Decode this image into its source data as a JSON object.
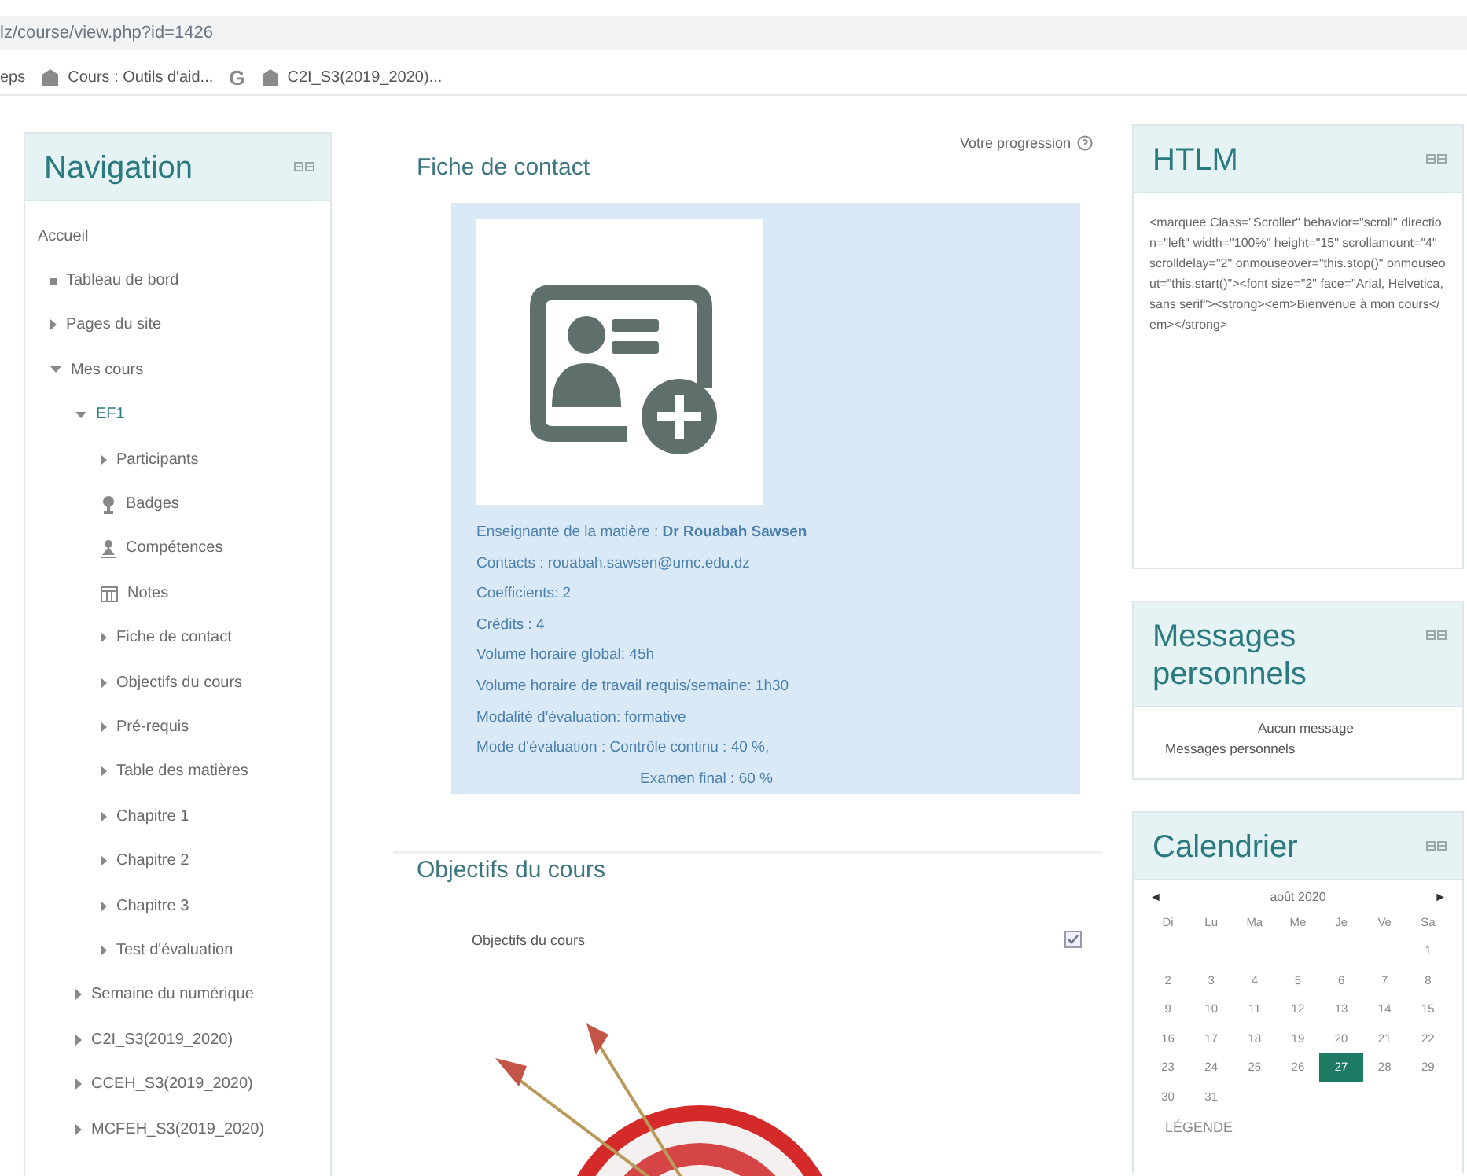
{
  "browser": {
    "url": "lz/course/view.php?id=1426",
    "bookmarks": [
      {
        "kind": "text",
        "label": "eps"
      },
      {
        "kind": "page",
        "label": "Cours : Outils d'aid..."
      },
      {
        "kind": "google",
        "label": "G"
      },
      {
        "kind": "page",
        "label": "C2I_S3(2019_2020)..."
      }
    ]
  },
  "navigation": {
    "title": "Navigation",
    "items": [
      {
        "kind": "plain",
        "label": "Accueil"
      },
      {
        "kind": "leaf",
        "label": "Tableau de bord"
      },
      {
        "kind": "branch",
        "label": "Pages du site",
        "expanded": false
      },
      {
        "kind": "branch",
        "label": "Mes cours",
        "expanded": true,
        "children": [
          {
            "kind": "branch",
            "label": "EF1",
            "expanded": true,
            "current": true,
            "children": [
              {
                "kind": "branch",
                "label": "Participants",
                "expanded": false
              },
              {
                "kind": "badge",
                "label": "Badges"
              },
              {
                "kind": "competence",
                "label": "Compétences"
              },
              {
                "kind": "grades",
                "label": "Notes"
              },
              {
                "kind": "branch",
                "label": "Fiche de contact",
                "expanded": false
              },
              {
                "kind": "branch",
                "label": "Objectifs du cours",
                "expanded": false
              },
              {
                "kind": "branch",
                "label": "Pré-requis",
                "expanded": false
              },
              {
                "kind": "branch",
                "label": "Table des matières",
                "expanded": false
              },
              {
                "kind": "branch",
                "label": "Chapitre 1",
                "expanded": false
              },
              {
                "kind": "branch",
                "label": "Chapitre 2",
                "expanded": false
              },
              {
                "kind": "branch",
                "label": "Chapitre 3",
                "expanded": false
              },
              {
                "kind": "branch",
                "label": "Test d'évaluation",
                "expanded": false
              }
            ]
          },
          {
            "kind": "branch",
            "label": "Semaine du numérique",
            "expanded": false
          },
          {
            "kind": "branch",
            "label": "C2I_S3(2019_2020)",
            "expanded": false
          },
          {
            "kind": "branch",
            "label": "CCEH_S3(2019_2020)",
            "expanded": false
          },
          {
            "kind": "branch",
            "label": "MCFEH_S3(2019_2020)",
            "expanded": false
          }
        ]
      }
    ]
  },
  "progress_label": "Votre progression",
  "contact_section": {
    "title": "Fiche de contact",
    "lines": [
      {
        "kind": "line",
        "text": "Enseignante de la matière :  **Dr Rouabah Sawsen**"
      },
      {
        "kind": "line",
        "text": "Contacts : rouabah.sawsen@umc.edu.dz"
      },
      {
        "kind": "line",
        "text": "Coefficients: 2"
      },
      {
        "kind": "line",
        "text": "Crédits : 4"
      },
      {
        "kind": "line",
        "text": "Volume horaire global: 45h"
      },
      {
        "kind": "line",
        "text": "Volume horaire de travail requis/semaine: 1h30"
      },
      {
        "kind": "line",
        "text": "Modalité d'évaluation: formative"
      },
      {
        "kind": "line",
        "text": "Mode d'évaluation :  Contrôle continu : 40 %,"
      },
      {
        "kind": "indented",
        "text": "Examen final : 60 %"
      }
    ]
  },
  "objectives_section": {
    "title": "Objectifs du cours",
    "items": [
      {
        "label": "Objectifs du cours",
        "checked": true
      }
    ]
  },
  "html_block": {
    "title": "HTLM",
    "code": "<marquee Class=\"Scroller\" behavior=\"scroll\" direction=\"left\" width=\"100%\" height=\"15\" scrollamount=\"4\" scrolldelay=\"2\" onmouseover=\"this.stop()\" onmouseout=\"this.start()\"><font size=\"2\" face=\"Arial, Helvetica, sans serif\"><strong><em>Bienvenue à mon cours</em></strong>"
  },
  "messages_block": {
    "title": "Messages personnels",
    "empty_text": "Aucun message",
    "link": "Messages personnels"
  },
  "calendar": {
    "title": "Calendrier",
    "prev": "◄",
    "next": "►",
    "month": "août 2020",
    "weekdays": [
      "Di",
      "Lu",
      "Ma",
      "Me",
      "Je",
      "Ve",
      "Sa"
    ],
    "weeks": [
      {
        "kind": "end",
        "days": [
          {
            "d": "1",
            "today": false
          }
        ]
      },
      {
        "kind": "full",
        "days": [
          {
            "d": "2",
            "today": false
          },
          {
            "d": "3",
            "today": false
          },
          {
            "d": "4",
            "today": false
          },
          {
            "d": "5",
            "today": false
          },
          {
            "d": "6",
            "today": false
          },
          {
            "d": "7",
            "today": false
          },
          {
            "d": "8",
            "today": false
          }
        ]
      },
      {
        "kind": "full",
        "days": [
          {
            "d": "9",
            "today": false
          },
          {
            "d": "10",
            "today": false
          },
          {
            "d": "11",
            "today": false
          },
          {
            "d": "12",
            "today": false
          },
          {
            "d": "13",
            "today": false
          },
          {
            "d": "14",
            "today": false
          },
          {
            "d": "15",
            "today": false
          }
        ]
      },
      {
        "kind": "full",
        "days": [
          {
            "d": "16",
            "today": false
          },
          {
            "d": "17",
            "today": false
          },
          {
            "d": "18",
            "today": false
          },
          {
            "d": "19",
            "today": false
          },
          {
            "d": "20",
            "today": false
          },
          {
            "d": "21",
            "today": false
          },
          {
            "d": "22",
            "today": false
          }
        ]
      },
      {
        "kind": "full",
        "days": [
          {
            "d": "23",
            "today": false
          },
          {
            "d": "24",
            "today": false
          },
          {
            "d": "25",
            "today": false
          },
          {
            "d": "26",
            "today": false
          },
          {
            "d": "27",
            "today": true
          },
          {
            "d": "28",
            "today": false
          },
          {
            "d": "29",
            "today": false
          }
        ]
      },
      {
        "kind": "start",
        "days": [
          {
            "d": "30",
            "today": false
          },
          {
            "d": "31",
            "today": false
          }
        ]
      }
    ],
    "legend": "LÉGENDE"
  }
}
